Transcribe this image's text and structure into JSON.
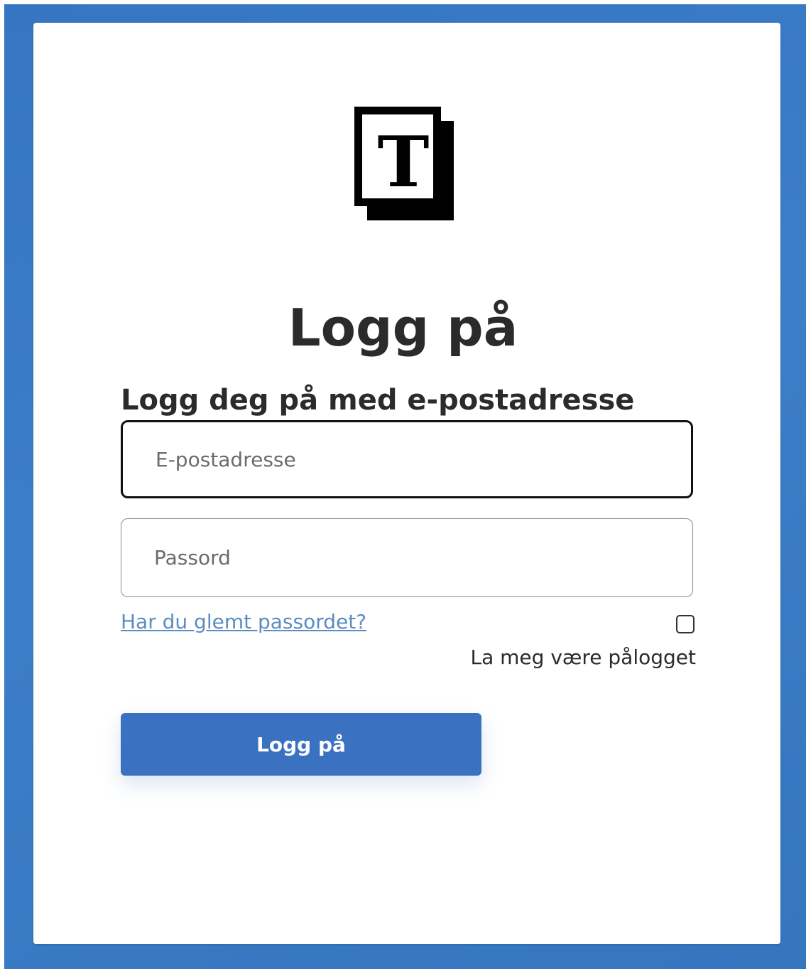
{
  "theme": {
    "background": "#3a78c4",
    "card": "#ffffff",
    "primary": "#3a71c0",
    "link": "#5b8dc1"
  },
  "logo": {
    "letter": "T",
    "icon": "document-t-logo-icon"
  },
  "page": {
    "title": "Logg på",
    "subtitle": "Logg deg på med e-postadresse"
  },
  "form": {
    "email": {
      "placeholder": "E-postadresse",
      "value": ""
    },
    "password": {
      "placeholder": "Passord",
      "value": ""
    },
    "forgot_password": "Har du glemt passordet?",
    "remember_me": {
      "label": "La meg være pålogget",
      "checked": false
    },
    "submit_label": "Logg på"
  }
}
